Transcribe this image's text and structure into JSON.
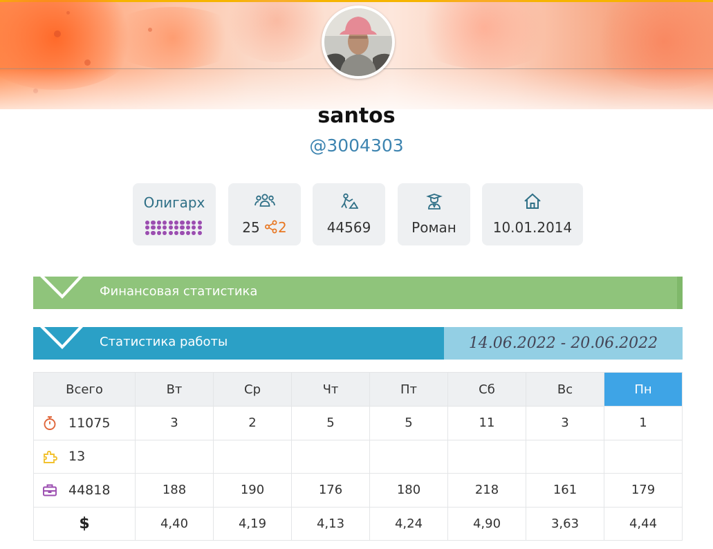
{
  "profile": {
    "name": "santos",
    "handle": "@3004303"
  },
  "cards": {
    "rank": {
      "title": "Олигарх",
      "icon": "purple-dots-icon",
      "dots": 30
    },
    "followers": {
      "icon": "users-icon",
      "count": "25",
      "shares": "2",
      "share_icon": "share-icon"
    },
    "tasks": {
      "icon": "worker-icon",
      "value": "44569"
    },
    "mentor": {
      "icon": "graduate-icon",
      "value": "Роман"
    },
    "joined": {
      "icon": "home-icon",
      "value": "10.01.2014"
    }
  },
  "sections": {
    "finance": {
      "label": "Финансовая статистика",
      "color": "#8fc47b"
    },
    "work": {
      "label": "Статистика работы",
      "date_range": "14.06.2022 - 20.06.2022",
      "color": "#2ba0c6"
    }
  },
  "table": {
    "headers": [
      "Всего",
      "Вт",
      "Ср",
      "Чт",
      "Пт",
      "Сб",
      "Вс",
      "Пн"
    ],
    "active_header_index": 7,
    "rows": [
      {
        "icon": "stopwatch-icon",
        "icon_color": "#e0663a",
        "total": "11075",
        "values": [
          "3",
          "2",
          "5",
          "5",
          "11",
          "3",
          "1"
        ]
      },
      {
        "icon": "puzzle-icon",
        "icon_color": "#f2c12e",
        "total": "13",
        "values": [
          "",
          "",
          "",
          "",
          "",
          "",
          ""
        ]
      },
      {
        "icon": "briefcase-icon",
        "icon_color": "#9b4db0",
        "total": "44818",
        "values": [
          "188",
          "190",
          "176",
          "180",
          "218",
          "161",
          "179"
        ]
      },
      {
        "icon": "dollar-icon",
        "total": "$",
        "values": [
          "4,40",
          "4,19",
          "4,13",
          "4,24",
          "4,90",
          "3,63",
          "4,44"
        ]
      }
    ]
  },
  "colors": {
    "accent": "#3d84b0",
    "active_day": "#3ea4e6",
    "card_bg": "#eef0f2"
  }
}
